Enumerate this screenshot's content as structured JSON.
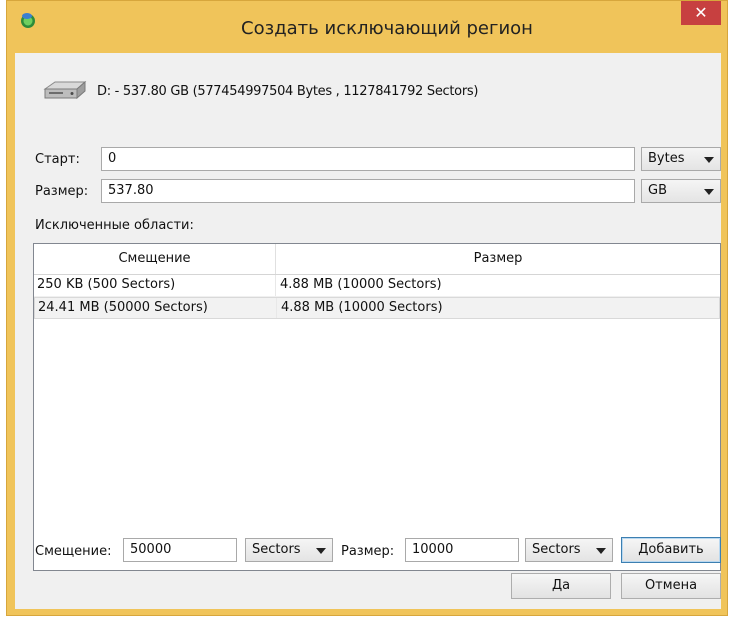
{
  "window": {
    "title": "Создать исключающий регион",
    "close_glyph": "✕"
  },
  "disk": {
    "icon": "hard-drive-icon",
    "info": "D: - 537.80 GB (577454997504 Bytes , 1127841792 Sectors)"
  },
  "start": {
    "label": "Старт:",
    "value": "0",
    "unit": "Bytes"
  },
  "size": {
    "label": "Размер:",
    "value": "537.80",
    "unit": "GB"
  },
  "excluded": {
    "label": "Исключенные области:",
    "columns": [
      "Смещение",
      "Размер"
    ],
    "rows": [
      {
        "offset": "250 KB (500 Sectors)",
        "size": "4.88 MB (10000 Sectors)"
      },
      {
        "offset": "24.41 MB (50000 Sectors)",
        "size": "4.88 MB (10000 Sectors)"
      }
    ]
  },
  "add_region": {
    "offset_label": "Смещение:",
    "offset_value": "50000",
    "offset_unit": "Sectors",
    "size_label": "Размер:",
    "size_value": "10000",
    "size_unit": "Sectors",
    "add_button": "Добавить"
  },
  "buttons": {
    "ok": "Да",
    "cancel": "Отмена"
  },
  "colors": {
    "titlebar": "#f0c45a",
    "close": "#c74040"
  }
}
